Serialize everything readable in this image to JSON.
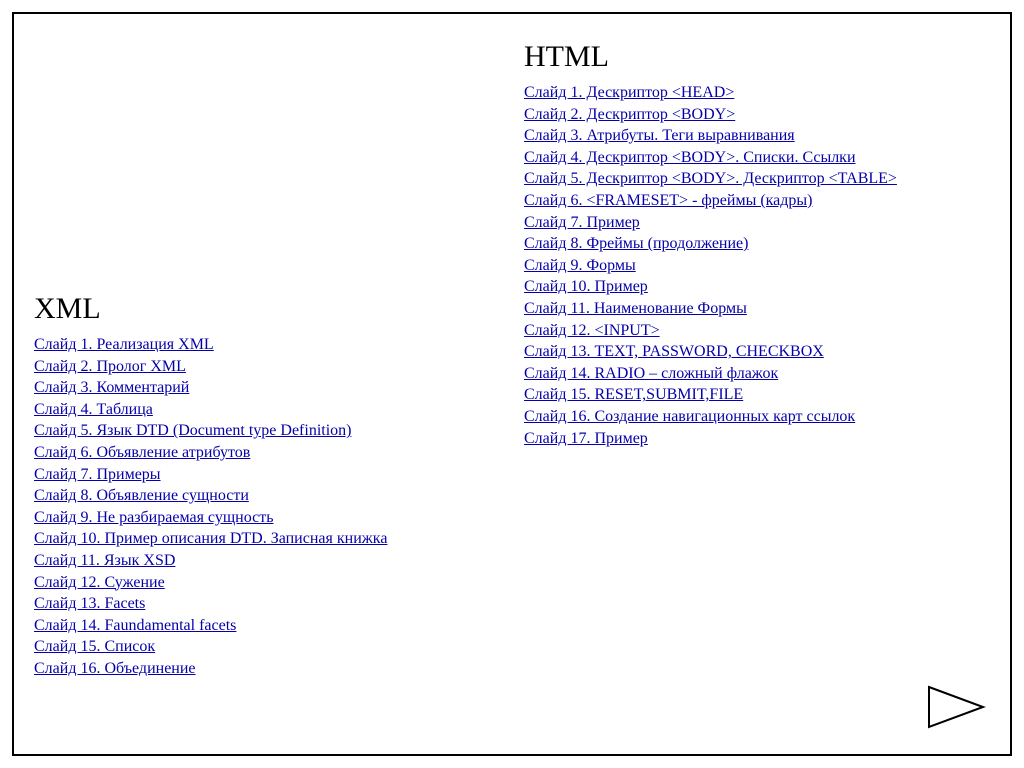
{
  "right": {
    "heading": "HTML",
    "links": [
      "Слайд 1. Дескриптор <HEAD>",
      "Слайд 2. Дескриптор <BODY>",
      "Слайд 3. Атрибуты. Теги выравнивания",
      "Слайд 4. Дескриптор <BODY>. Списки. Ссылки",
      "Слайд 5. Дескриптор <BODY>. Дескриптор <TABLE>",
      "Слайд 6. <FRAMESET> - фреймы (кадры)",
      "Слайд 7. Пример",
      "Слайд 8. Фреймы (продолжение)",
      "Слайд 9. Формы",
      "Слайд 10. Пример",
      "Слайд 11. Наименование Формы",
      "Слайд 12. <INPUT>",
      "Слайд 13. TEXT, PASSWORD, CHECKBOX",
      "Слайд 14. RADIO – сложный флажок",
      "Слайд 15. RESET,SUBMIT,FILE",
      "Слайд 16. Создание навигационных карт ссылок",
      "Слайд 17. Пример"
    ]
  },
  "left": {
    "heading": "XML",
    "links": [
      "Слайд 1. Реализация XML",
      "Слайд 2. Пролог XML",
      "Слайд 3. Комментарий",
      "Слайд 4. Таблица",
      "Слайд 5. Язык DTD (Document type Definition)",
      "Слайд 6. Объявление атрибутов",
      "Слайд 7. Примеры",
      "Слайд 8. Объявление сущности",
      "Слайд 9. Не разбираемая сущность",
      "Слайд 10. Пример описания DTD. Записная книжка",
      "Слайд 11. Язык XSD",
      "Слайд 12. Сужение",
      "Слайд 13. Facets",
      "Слайд 14. Faundamental facets",
      "Слайд 15. Список",
      "Слайд 16. Объединение"
    ]
  }
}
